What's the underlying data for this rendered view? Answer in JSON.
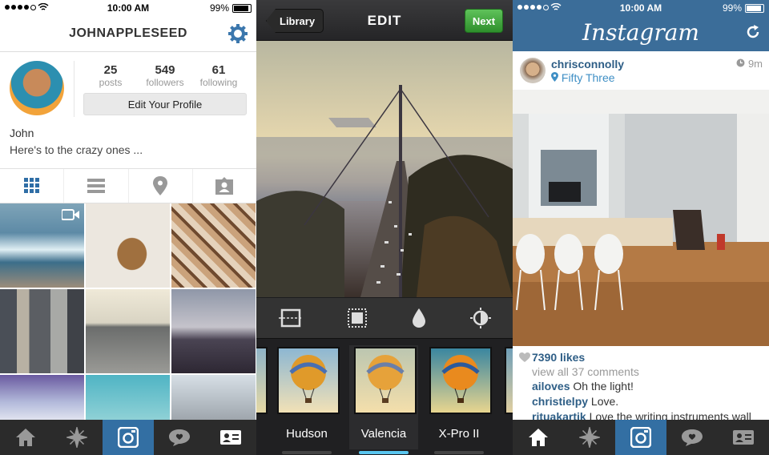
{
  "colors": {
    "ig_blue": "#3b6d99",
    "tab_active": "#336fa3",
    "next_green": "#43a73f",
    "link_blue": "#2e5e86",
    "filter_selected": "#5ac6ef"
  },
  "profile_screen": {
    "status": {
      "time": "10:00 AM",
      "battery": "99%"
    },
    "username": "JOHNAPPLESEED",
    "stats": [
      {
        "value": "25",
        "label": "posts"
      },
      {
        "value": "549",
        "label": "followers"
      },
      {
        "value": "61",
        "label": "following"
      }
    ],
    "edit_profile_label": "Edit Your Profile",
    "name": "John",
    "bio": "Here's to the crazy ones ...",
    "view_tabs": [
      "grid-icon",
      "list-icon",
      "map-pin-icon",
      "tagged-person-icon"
    ],
    "tab_bar": [
      "home-icon",
      "explore-icon",
      "camera-icon",
      "news-icon",
      "profile-icon"
    ],
    "active_tab": "camera-icon"
  },
  "edit_screen": {
    "back_label": "Library",
    "title": "EDIT",
    "next_label": "Next",
    "tools": [
      "crop-icon",
      "border-icon",
      "tilt-shift-icon",
      "lux-icon"
    ],
    "filters": [
      {
        "label": "Hudson"
      },
      {
        "label": "Valencia",
        "selected": true
      },
      {
        "label": "X-Pro II"
      }
    ]
  },
  "feed_screen": {
    "status": {
      "time": "10:00 AM",
      "battery": "99%"
    },
    "logo": "Instagram",
    "post": {
      "user": "chrisconnolly",
      "location": "Fifty Three",
      "time": "9m",
      "likes": "7390 likes",
      "view_all": "view all 37 comments",
      "comments": [
        {
          "user": "ailoves",
          "text": " Oh the light!"
        },
        {
          "user": "christielpy",
          "text": " Love."
        },
        {
          "user": "rituakartik",
          "text": " Love the writing instruments wall"
        }
      ]
    }
  }
}
